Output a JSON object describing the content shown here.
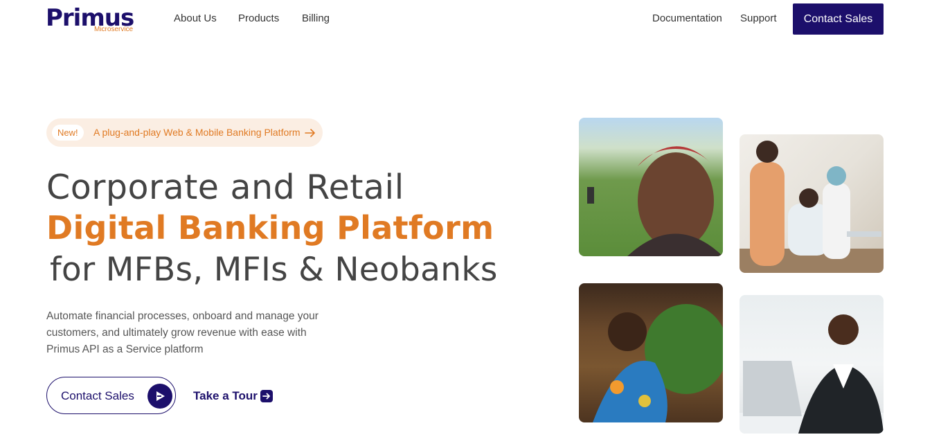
{
  "brand": {
    "name": "Primus",
    "sub": "Microservice"
  },
  "nav": {
    "left": [
      "About Us",
      "Products",
      "Billing"
    ],
    "right": [
      "Documentation",
      "Support"
    ],
    "cta": "Contact Sales"
  },
  "hero": {
    "pill_badge": "New!",
    "pill_text": "A plug-and-play Web & Mobile Banking Platform",
    "line1": "Corporate and Retail",
    "line2": "Digital Banking Platform",
    "line3": "for MFBs, MFIs & Neobanks",
    "description": "Automate financial processes, onboard and manage your customers, and ultimately grow revenue with ease with Primus API as a Service platform",
    "primary_cta": "Contact Sales",
    "secondary_cta": "Take a Tour"
  },
  "colors": {
    "brand": "#1c0f6b",
    "accent": "#e07a23"
  },
  "icons": {
    "pill": "arrow-right-icon",
    "primary_cta": "play-icon",
    "secondary_cta": "arrow-right-square-icon"
  }
}
